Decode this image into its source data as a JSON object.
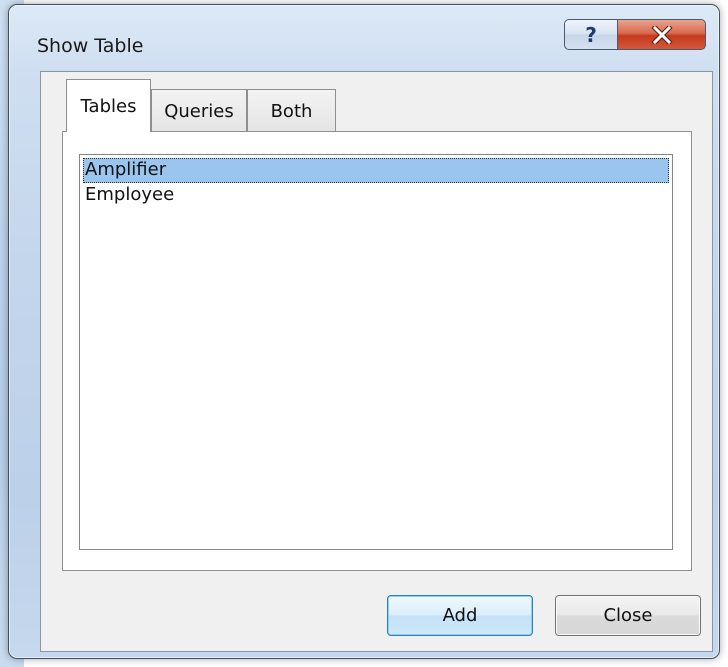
{
  "window": {
    "title": "Show Table",
    "help_glyph": "?",
    "close_icon": "close-icon"
  },
  "tabs": [
    {
      "label": "Tables",
      "active": true
    },
    {
      "label": "Queries",
      "active": false
    },
    {
      "label": "Both",
      "active": false
    }
  ],
  "list": {
    "items": [
      {
        "label": "Amplifier",
        "selected": true
      },
      {
        "label": "Employee",
        "selected": false
      }
    ]
  },
  "buttons": {
    "add_label": "Add",
    "close_label": "Close"
  },
  "colors": {
    "selection": "#99c5ef",
    "close_button_red": "#c53a1f",
    "default_button_border": "#2c7fb8"
  }
}
